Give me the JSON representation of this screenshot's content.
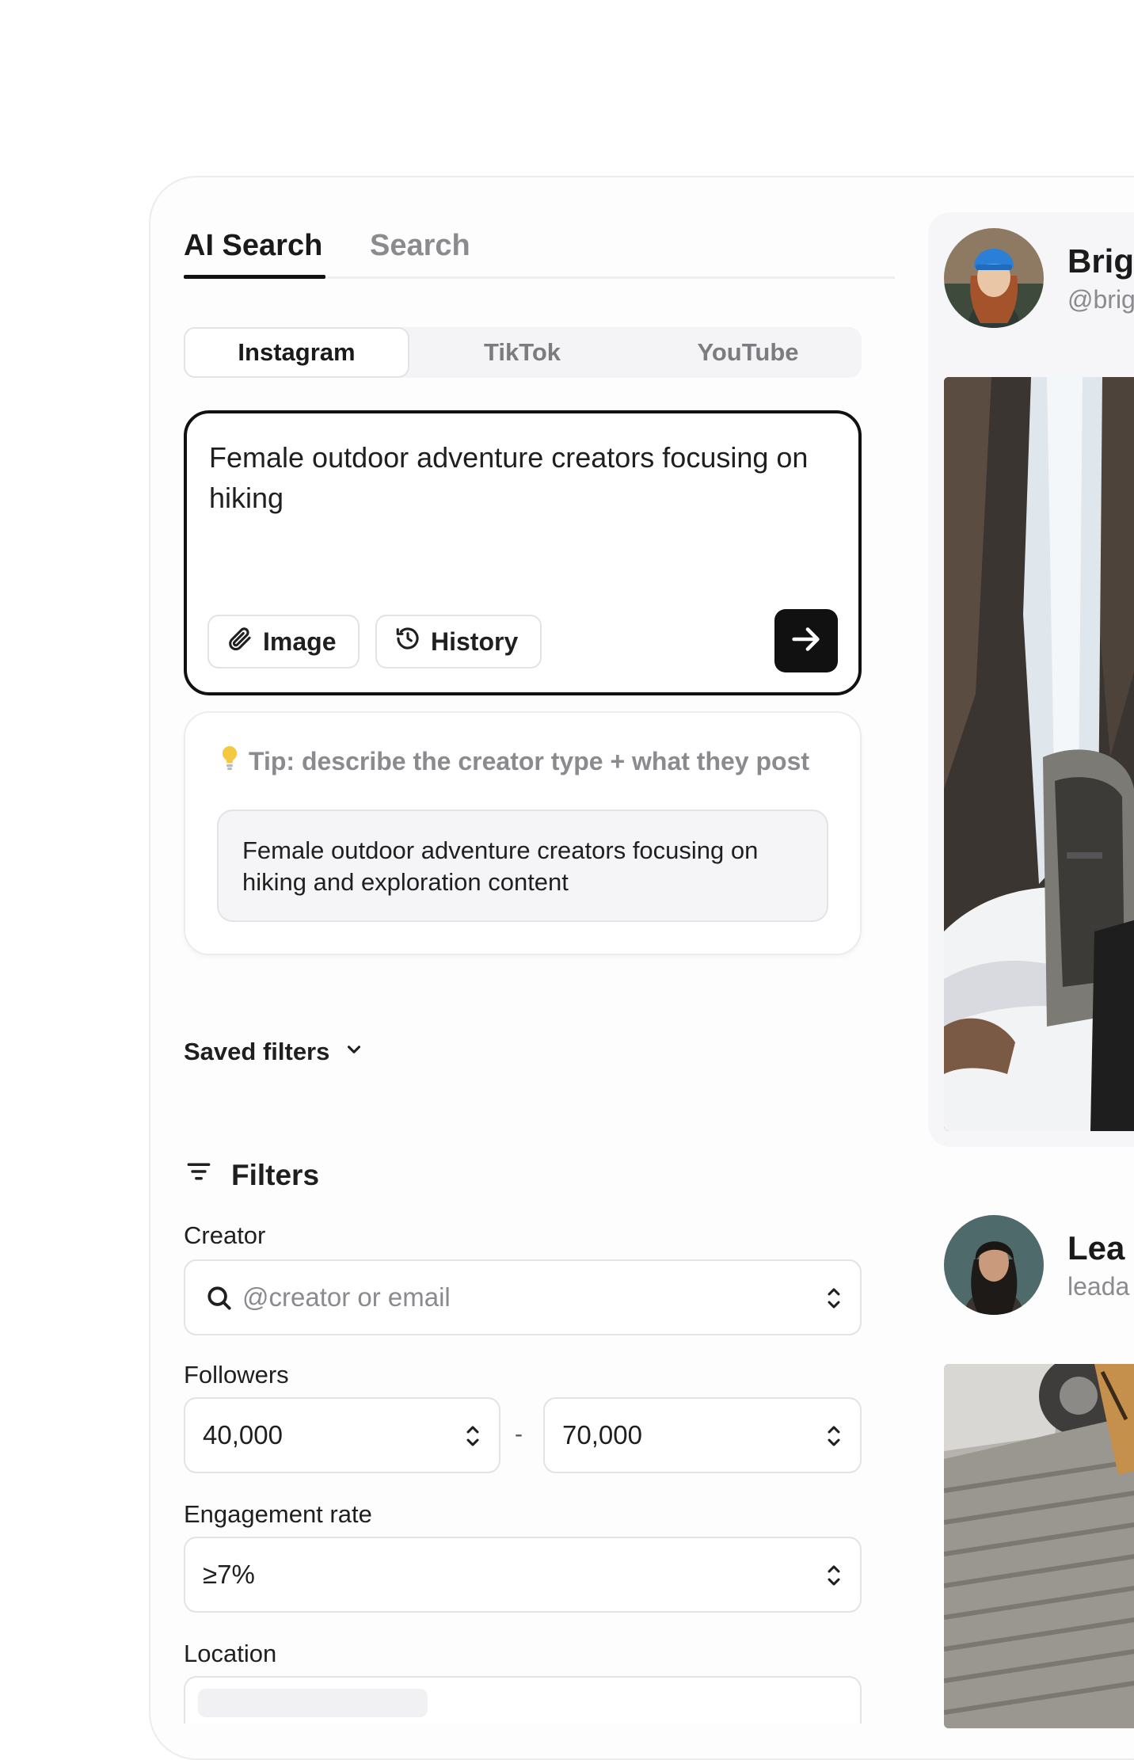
{
  "tabs": {
    "ai_search": "AI Search",
    "search": "Search"
  },
  "platforms": [
    "Instagram",
    "TikTok",
    "YouTube"
  ],
  "active_platform": "Instagram",
  "query": {
    "text": "Female outdoor adventure creators focusing on hiking",
    "image_label": "Image",
    "history_label": "History"
  },
  "tip": {
    "text": "Tip: describe the creator type + what they post",
    "example": "Female outdoor adventure creators focusing on hiking and exploration content"
  },
  "saved_filters": {
    "label": "Saved filters"
  },
  "filters": {
    "heading": "Filters",
    "creator": {
      "label": "Creator",
      "placeholder": "@creator or email"
    },
    "followers": {
      "label": "Followers",
      "min": "40,000",
      "separator": "-",
      "max": "70,000"
    },
    "engagement": {
      "label": "Engagement rate",
      "value": "≥7%"
    },
    "location": {
      "label": "Location"
    }
  },
  "creators": [
    {
      "name": "Brig",
      "handle": "@brig"
    },
    {
      "name": "Lea",
      "handle": "leada"
    }
  ],
  "colors": {
    "accent": "#111111",
    "muted": "#8a8a8f",
    "border": "#e3e3e6",
    "panel": "#f6f6f8"
  }
}
